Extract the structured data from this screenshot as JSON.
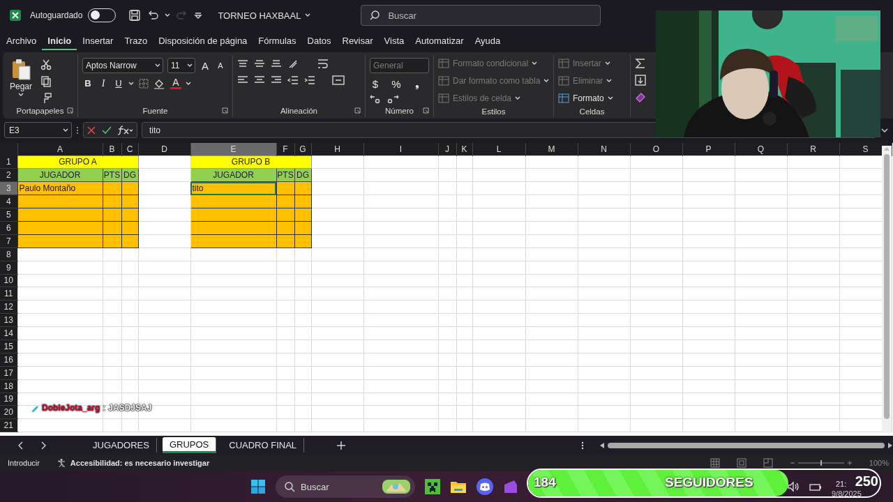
{
  "title_bar": {
    "autosave_label": "Autoguardado",
    "autosave_on": false,
    "file_name": "TORNEO HAXBAAL",
    "search_placeholder": "Buscar"
  },
  "menu_tabs": [
    {
      "label": "Archivo",
      "selected": false
    },
    {
      "label": "Inicio",
      "selected": true
    },
    {
      "label": "Insertar",
      "selected": false
    },
    {
      "label": "Trazo",
      "selected": false
    },
    {
      "label": "Disposición de página",
      "selected": false
    },
    {
      "label": "Fórmulas",
      "selected": false
    },
    {
      "label": "Datos",
      "selected": false
    },
    {
      "label": "Revisar",
      "selected": false
    },
    {
      "label": "Vista",
      "selected": false
    },
    {
      "label": "Automatizar",
      "selected": false
    },
    {
      "label": "Ayuda",
      "selected": false
    }
  ],
  "ribbon": {
    "paste_label": "Pegar",
    "font_name": "Aptos Narrow",
    "font_size": "11",
    "grow_font": "A",
    "shrink_font": "A",
    "font_style_buttons": [
      "B",
      "I",
      "U"
    ],
    "font_color": "A",
    "number_format": "General",
    "number_buttons": [
      "$",
      "%",
      "❟"
    ],
    "styles_items": [
      {
        "label": "Formato condicional",
        "disabled": true
      },
      {
        "label": "Dar formato como tabla",
        "disabled": true
      },
      {
        "label": "Estilos de celda",
        "disabled": true
      }
    ],
    "cells_items": [
      {
        "label": "Insertar",
        "disabled": true
      },
      {
        "label": "Eliminar",
        "disabled": true
      },
      {
        "label": "Formato",
        "disabled": false
      }
    ],
    "group_labels": [
      "Portapapeles",
      "Fuente",
      "Alineación",
      "Número",
      "Estilos",
      "Celdas"
    ]
  },
  "formula_bar": {
    "name_box": "E3",
    "value": "tito"
  },
  "sheet": {
    "columns": [
      {
        "label": "A",
        "selected": false
      },
      {
        "label": "B",
        "selected": false
      },
      {
        "label": "C",
        "selected": false
      },
      {
        "label": "D",
        "selected": false
      },
      {
        "label": "E",
        "selected": true
      },
      {
        "label": "F",
        "selected": false
      },
      {
        "label": "G",
        "selected": false
      },
      {
        "label": "H",
        "selected": false
      },
      {
        "label": "I",
        "selected": false
      },
      {
        "label": "J",
        "selected": false
      },
      {
        "label": "K",
        "selected": false
      },
      {
        "label": "L",
        "selected": false
      },
      {
        "label": "M",
        "selected": false
      },
      {
        "label": "N",
        "selected": false
      },
      {
        "label": "O",
        "selected": false
      },
      {
        "label": "P",
        "selected": false
      },
      {
        "label": "Q",
        "selected": false
      },
      {
        "label": "R",
        "selected": false
      },
      {
        "label": "S",
        "selected": false
      }
    ],
    "rows": [
      {
        "label": "1",
        "selected": false
      },
      {
        "label": "2",
        "selected": false
      },
      {
        "label": "3",
        "selected": true
      },
      {
        "label": "4",
        "selected": false
      },
      {
        "label": "5",
        "selected": false
      },
      {
        "label": "6",
        "selected": false
      },
      {
        "label": "7",
        "selected": false
      },
      {
        "label": "8",
        "selected": false
      },
      {
        "label": "9",
        "selected": false
      },
      {
        "label": "10",
        "selected": false
      },
      {
        "label": "11",
        "selected": false
      },
      {
        "label": "12",
        "selected": false
      },
      {
        "label": "13",
        "selected": false
      },
      {
        "label": "14",
        "selected": false
      },
      {
        "label": "15",
        "selected": false
      },
      {
        "label": "16",
        "selected": false
      },
      {
        "label": "17",
        "selected": false
      },
      {
        "label": "18",
        "selected": false
      },
      {
        "label": "19",
        "selected": false
      },
      {
        "label": "20",
        "selected": false
      },
      {
        "label": "21",
        "selected": false
      }
    ],
    "groups": [
      {
        "title": "GRUPO A",
        "headers": [
          "JUGADOR",
          "PTS",
          "DG"
        ],
        "players": [
          "Paulo Montaño"
        ]
      },
      {
        "title": "GRUPO B",
        "headers": [
          "JUGADOR",
          "PTS",
          "DG"
        ],
        "players": [
          "tito"
        ]
      }
    ]
  },
  "chat": {
    "user": "DobleJota_arg",
    "separator": ":",
    "message": "JASDJSAJ"
  },
  "sheet_tabs": [
    {
      "label": "JUGADORES",
      "selected": false
    },
    {
      "label": "GRUPOS",
      "selected": true
    },
    {
      "label": "CUADRO FINAL",
      "selected": false
    }
  ],
  "status_bar": {
    "mode": "Introducir",
    "accessibility": "Accesibilidad: es necesario investigar",
    "zoom": "100%"
  },
  "taskbar": {
    "search_placeholder": "Buscar",
    "time": "21:",
    "date": "9/8/2025"
  },
  "followers": {
    "count": "184",
    "label": "SEGUIDORES",
    "goal": "250",
    "level": 0.74
  }
}
